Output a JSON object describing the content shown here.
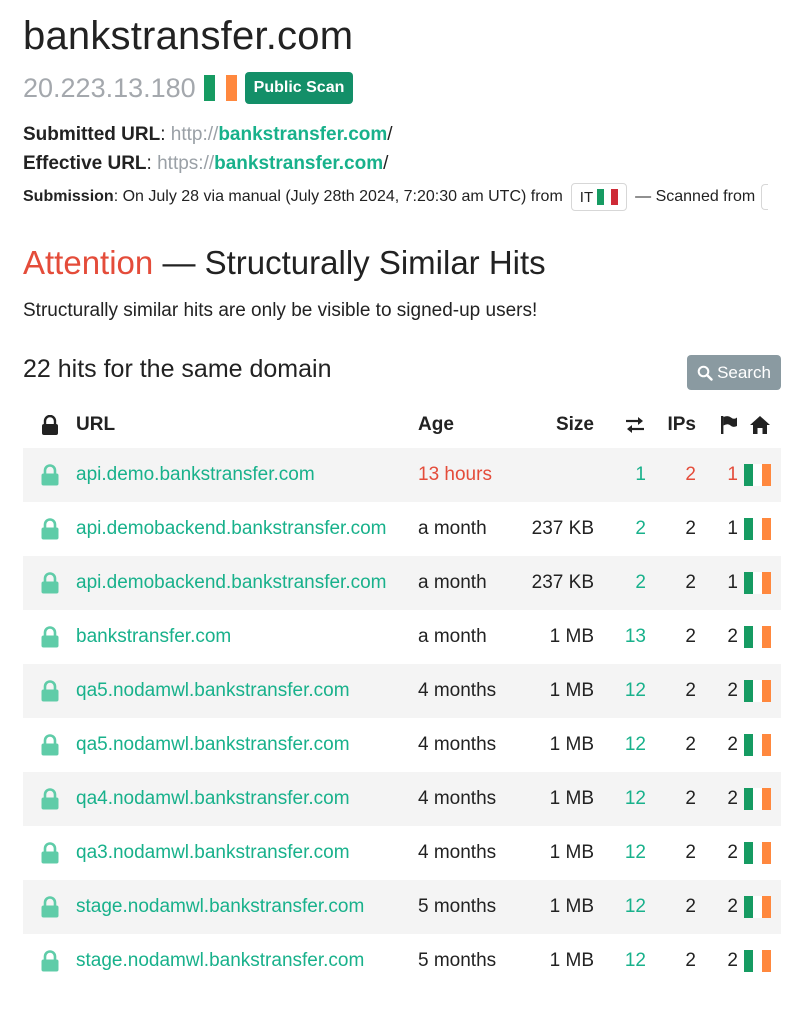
{
  "header": {
    "title": "bankstransfer.com",
    "ip": "20.223.13.180",
    "badge": "Public Scan"
  },
  "meta": {
    "submitted_label": "Submitted URL",
    "submitted_prefix": "http://",
    "submitted_domain": "bankstransfer.com",
    "submitted_suffix": "/",
    "effective_label": "Effective URL",
    "effective_prefix": "https://",
    "effective_domain": "bankstransfer.com",
    "effective_suffix": "/",
    "submission_label": "Submission",
    "submission_text": ": On July 28 via manual (July 28th 2024, 7:20:30 am UTC) from",
    "country_code": "IT",
    "scanned_from": "— Scanned from"
  },
  "attention": {
    "label": "Attention",
    "rest": "— Structurally Similar Hits",
    "note": "Structurally similar hits are only be visible to signed-up users!"
  },
  "hits": {
    "title": "22 hits for the same domain",
    "search_label": "Search",
    "columns": {
      "url": "URL",
      "age": "Age",
      "size": "Size",
      "ips": "IPs"
    },
    "rows": [
      {
        "url": "api.demo.bankstransfer.com",
        "age": "13 hours",
        "size": "",
        "transactions": "1",
        "ips": "2",
        "countries": "1"
      },
      {
        "url": "api.demobackend.bankstransfer.com",
        "age": "a month",
        "size": "237 KB",
        "transactions": "2",
        "ips": "2",
        "countries": "1"
      },
      {
        "url": "api.demobackend.bankstransfer.com",
        "age": "a month",
        "size": "237 KB",
        "transactions": "2",
        "ips": "2",
        "countries": "1"
      },
      {
        "url": "bankstransfer.com",
        "age": "a month",
        "size": "1 MB",
        "transactions": "13",
        "ips": "2",
        "countries": "2"
      },
      {
        "url": "qa5.nodamwl.bankstransfer.com",
        "age": "4 months",
        "size": "1 MB",
        "transactions": "12",
        "ips": "2",
        "countries": "2"
      },
      {
        "url": "qa5.nodamwl.bankstransfer.com",
        "age": "4 months",
        "size": "1 MB",
        "transactions": "12",
        "ips": "2",
        "countries": "2"
      },
      {
        "url": "qa4.nodamwl.bankstransfer.com",
        "age": "4 months",
        "size": "1 MB",
        "transactions": "12",
        "ips": "2",
        "countries": "2"
      },
      {
        "url": "qa3.nodamwl.bankstransfer.com",
        "age": "4 months",
        "size": "1 MB",
        "transactions": "12",
        "ips": "2",
        "countries": "2"
      },
      {
        "url": "stage.nodamwl.bankstransfer.com",
        "age": "5 months",
        "size": "1 MB",
        "transactions": "12",
        "ips": "2",
        "countries": "2"
      },
      {
        "url": "stage.nodamwl.bankstransfer.com",
        "age": "5 months",
        "size": "1 MB",
        "transactions": "12",
        "ips": "2",
        "countries": "2"
      }
    ]
  },
  "colors": {
    "accent_green": "#18b18b",
    "badge_green": "#138f68",
    "attention_red": "#e44c3a",
    "search_button": "#8a9aa1",
    "ireland_flag": [
      "#169b62",
      "#ffffff",
      "#ff883e"
    ],
    "italy_flag": [
      "#169b62",
      "#ffffff",
      "#ce2b37"
    ]
  },
  "icons": {
    "lock_header": "lock-icon",
    "lock_row": "lock-icon",
    "transactions": "arrows-exchange-icon",
    "countries": "flag-icon",
    "home": "home-icon",
    "search": "search-icon"
  }
}
